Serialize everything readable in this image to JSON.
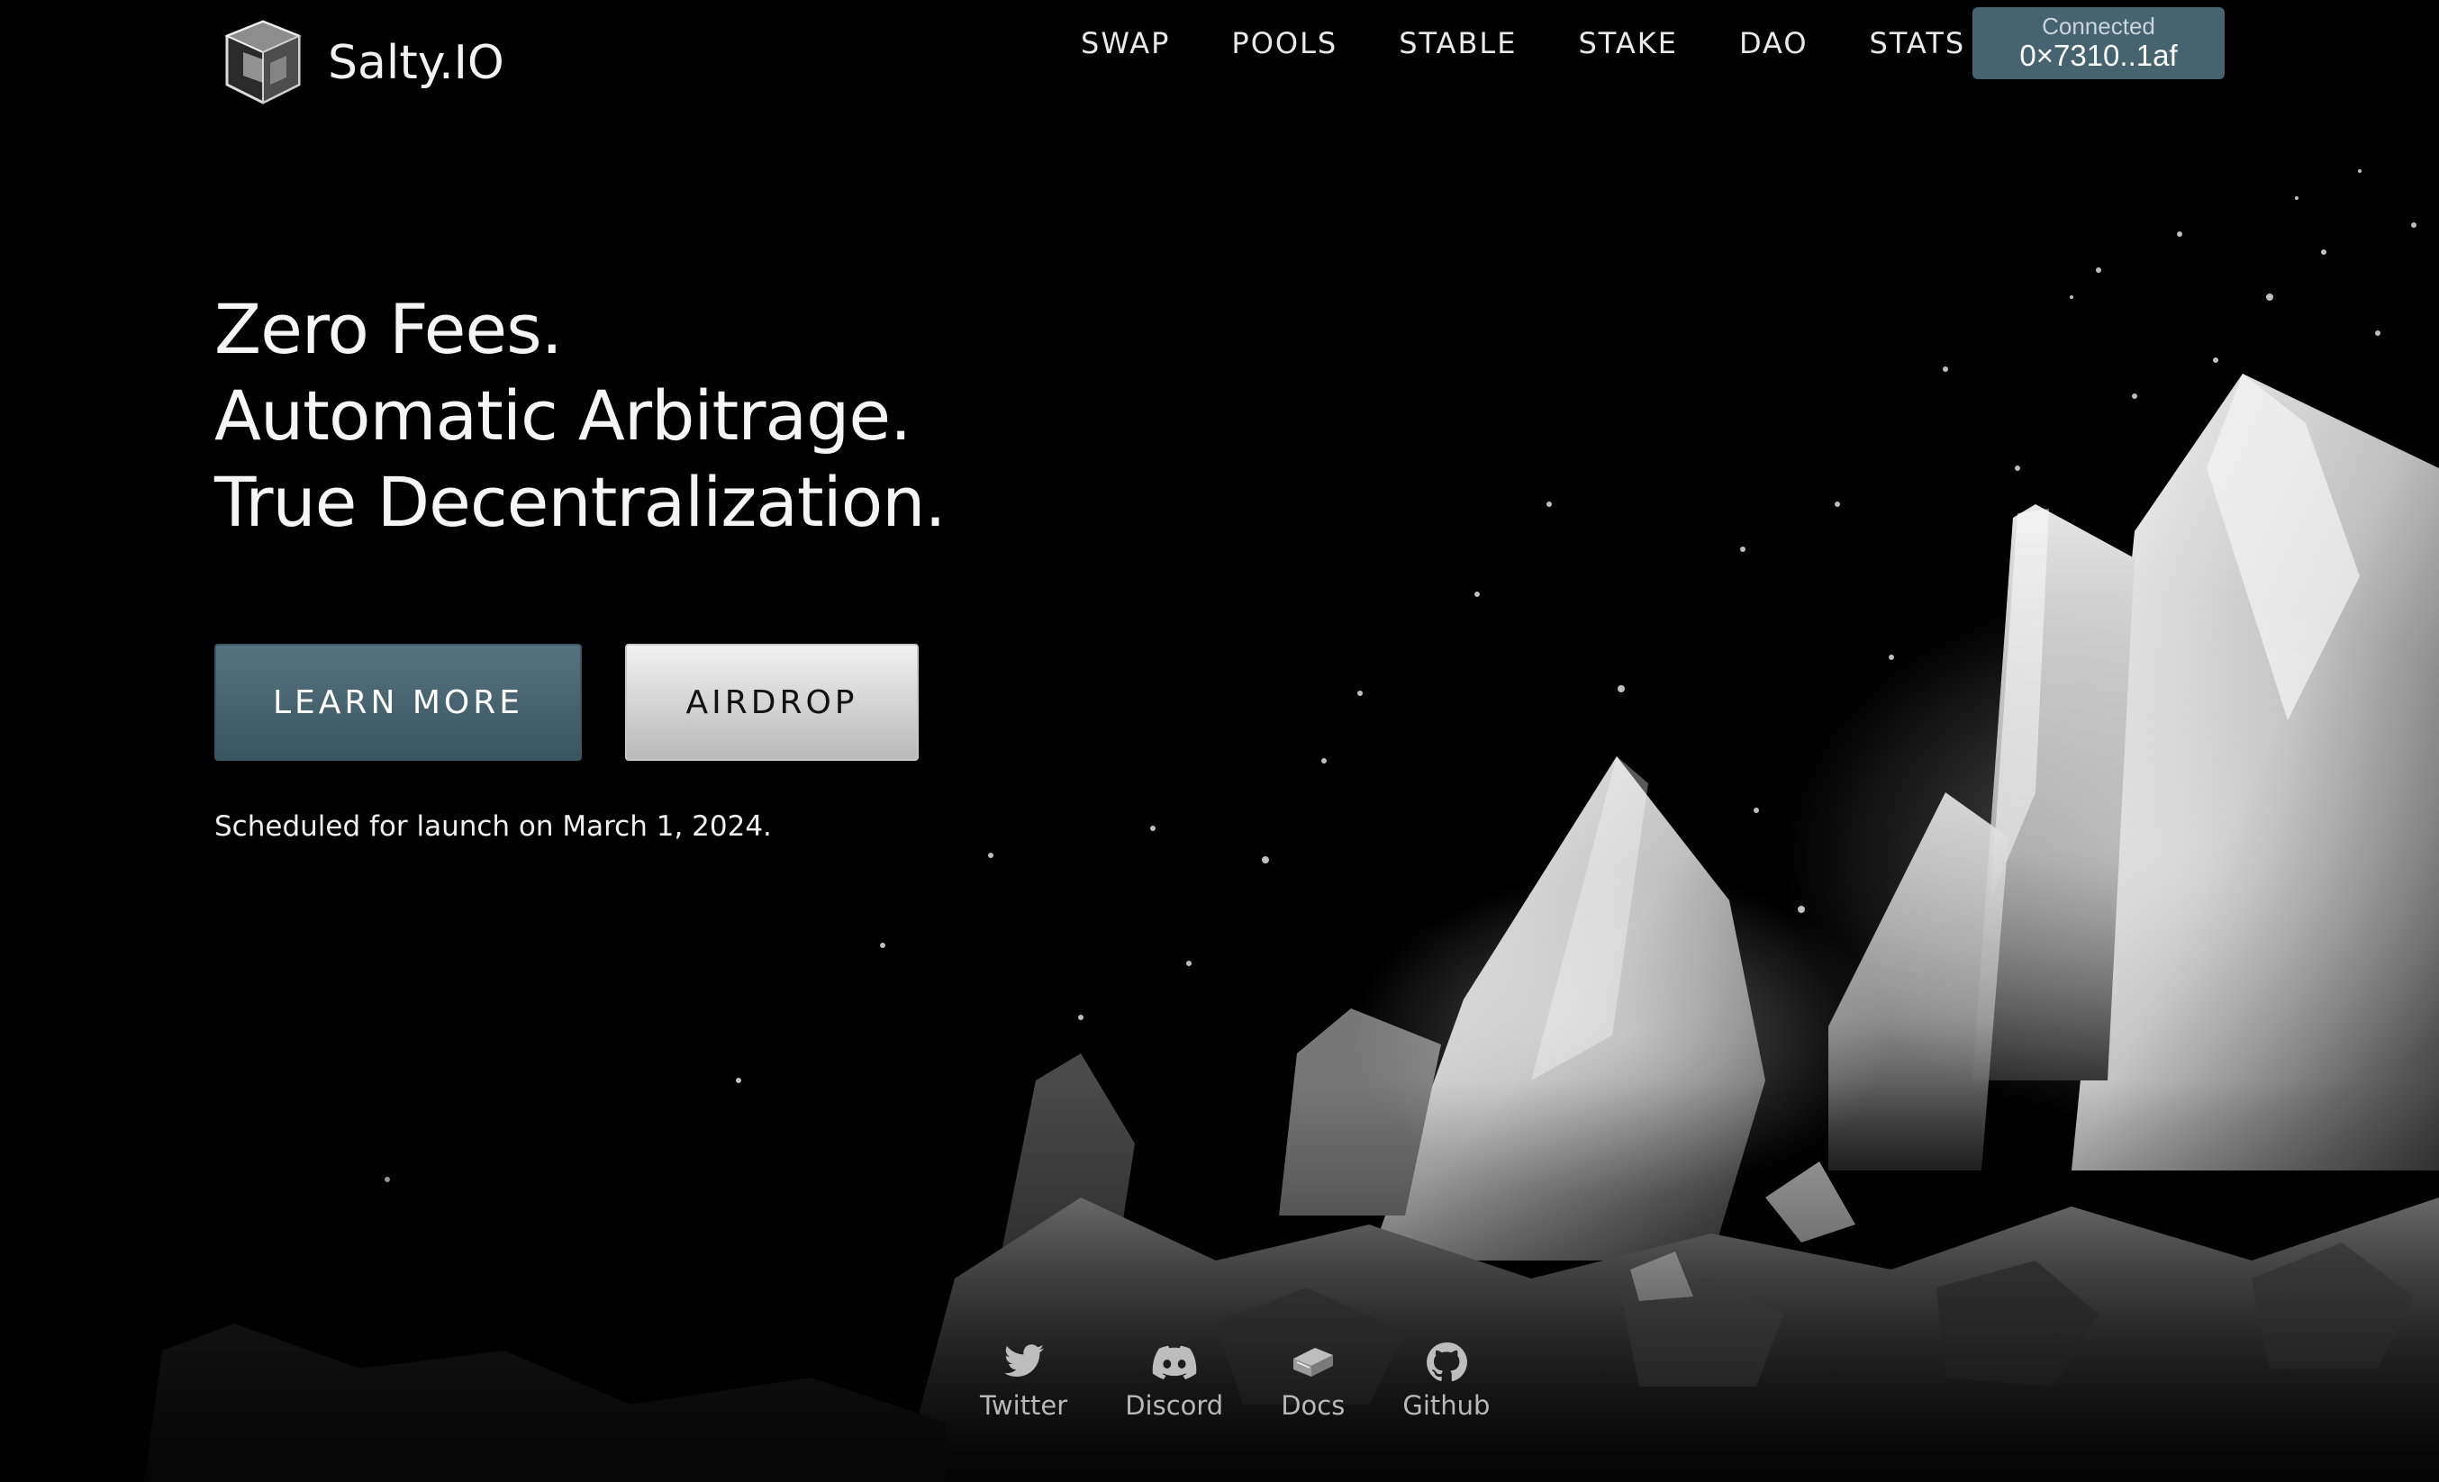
{
  "brand": {
    "name": "Salty.IO",
    "logo_icon": "glass-cube-icon"
  },
  "nav": {
    "items": [
      {
        "label": "SWAP"
      },
      {
        "label": "POOLS"
      },
      {
        "label": "STABLE"
      },
      {
        "label": "STAKE"
      },
      {
        "label": "DAO"
      },
      {
        "label": "STATS"
      }
    ]
  },
  "wallet": {
    "status": "Connected",
    "address": "0×7310..1af",
    "color": "#456470"
  },
  "hero": {
    "headline_lines": [
      "Zero Fees.",
      "Automatic Arbitrage.",
      "True Decentralization."
    ],
    "primary_cta": "LEARN MORE",
    "secondary_cta": "AIRDROP",
    "launch_note": "Scheduled for launch on March 1, 2024.",
    "background_art": "crystal-mountain-illustration"
  },
  "social": {
    "items": [
      {
        "label": "Twitter",
        "icon": "twitter-icon"
      },
      {
        "label": "Discord",
        "icon": "discord-icon"
      },
      {
        "label": "Docs",
        "icon": "book-icon"
      },
      {
        "label": "Github",
        "icon": "github-icon"
      }
    ]
  },
  "colors": {
    "background": "#000000",
    "accent": "#456470",
    "secondary_button": "#d9d9d9"
  }
}
